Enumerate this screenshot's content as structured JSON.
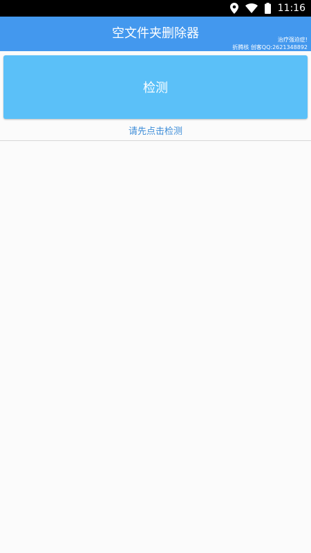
{
  "status_bar": {
    "time": "11:16",
    "icons": [
      "location-icon",
      "wifi-icon",
      "battery-icon"
    ]
  },
  "app_bar": {
    "title": "空文件夹删除器",
    "note_line1": "治疗强迫症!",
    "note_line2": "折腾核 创客QQ:2621348892"
  },
  "main": {
    "detect_button_label": "检测",
    "hint": "请先点击检测"
  },
  "colors": {
    "status_bar": "#000000",
    "app_bar": "#4398ee",
    "button": "#5bc0f8",
    "hint_text": "#3f8ed8",
    "background": "#fbfbfb"
  }
}
